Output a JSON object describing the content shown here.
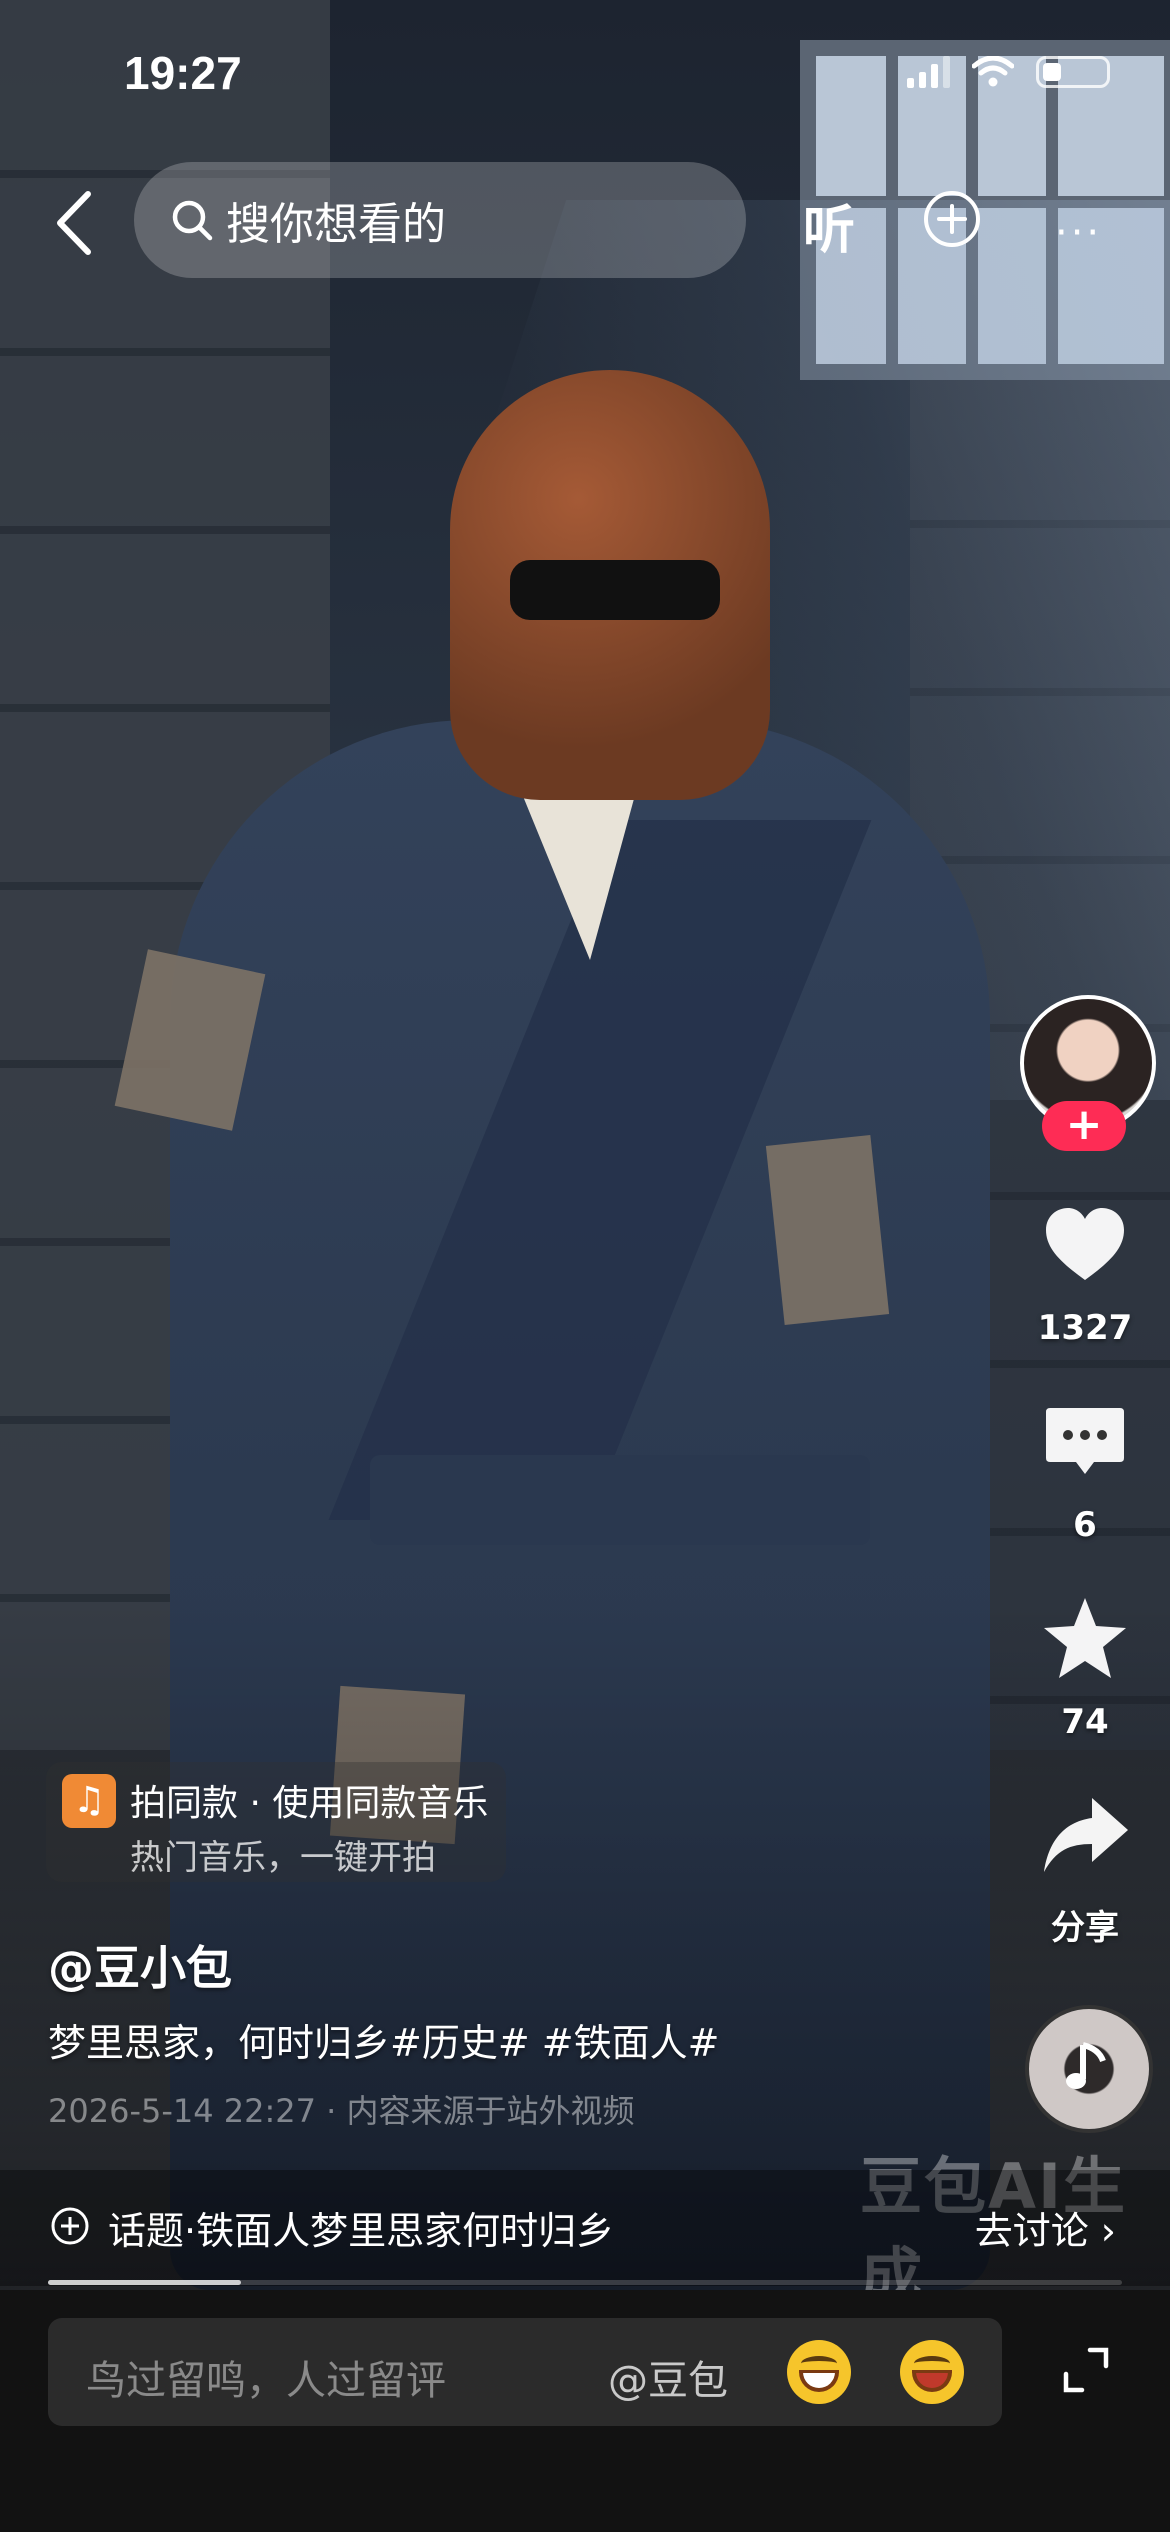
{
  "status_bar": {
    "time": "19:27"
  },
  "top_bar": {
    "search_placeholder": "搜你想看的",
    "listen_label": "听"
  },
  "side_rail": {
    "likes": "1327",
    "comments": "6",
    "favorites": "74",
    "share_label": "分享"
  },
  "music_chip": {
    "line1": "拍同款 · 使用同款音乐",
    "line2": "热门音乐，一键开拍"
  },
  "post": {
    "author": "@豆小包",
    "caption": "梦里思家，何时归乡#历史# #铁面人#",
    "meta": "2026-5-14 22:27 · 内容来源于站外视频",
    "watermark": "豆包AI生成"
  },
  "topic_bar": {
    "topic": "话题·铁面人梦里思家何时归乡",
    "discuss": "去讨论 ›"
  },
  "progress": {
    "fraction": 0.18
  },
  "comment_bar": {
    "placeholder": "鸟过留鸣，人过留评",
    "mention": "@豆包"
  },
  "icons": [
    "back-icon",
    "search-icon",
    "add-circle-icon",
    "more-icon",
    "heart-icon",
    "comment-icon",
    "star-icon",
    "share-icon",
    "music-note-icon",
    "plus-circle-icon",
    "emoji-grin-icon",
    "emoji-laugh-icon",
    "expand-icon"
  ],
  "colors": {
    "accent": "#fe2c55",
    "music": "#f08a35"
  }
}
